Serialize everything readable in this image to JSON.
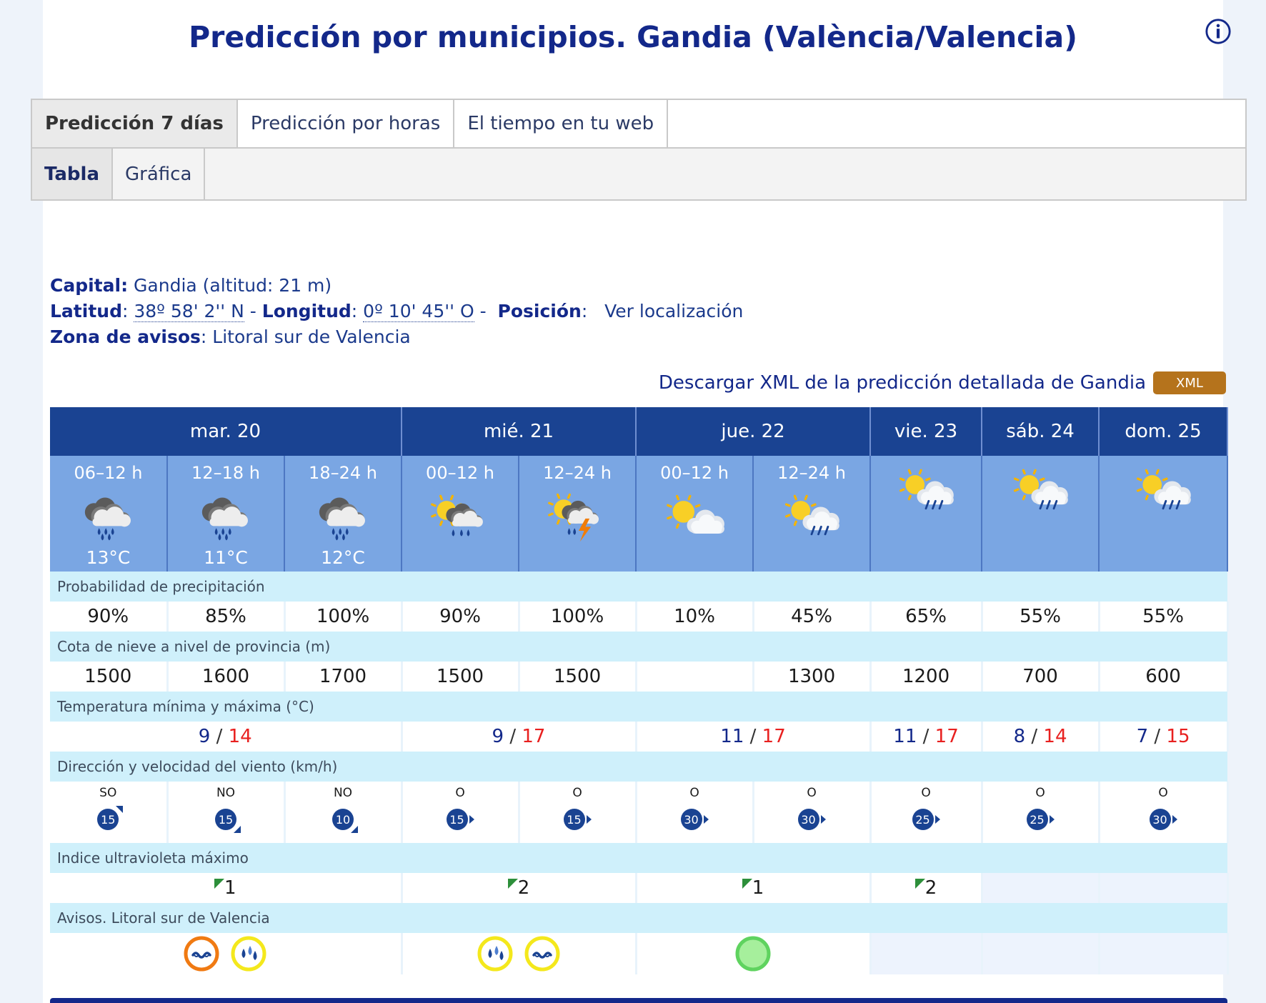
{
  "page": {
    "title": "Predicción por municipios. Gandia (València/Valencia)"
  },
  "tabs_main": [
    {
      "label": "Predicción 7 días",
      "active": true
    },
    {
      "label": "Predicción por horas",
      "active": false
    },
    {
      "label": "El tiempo en tu web",
      "active": false
    }
  ],
  "tabs_sub": [
    {
      "label": "Tabla",
      "active": true
    },
    {
      "label": "Gráfica",
      "active": false
    }
  ],
  "meta": {
    "capital_label": "Capital:",
    "capital_value": "Gandia (altitud: 21 m)",
    "lat_label": "Latitud",
    "lat_value": "38º 58' 2'' N",
    "lon_label": "Longitud",
    "lon_value": "0º 10' 45'' O",
    "pos_label": "Posición",
    "pos_value": "Ver localización",
    "zona_label": "Zona de avisos",
    "zona_value": "Litoral sur de Valencia",
    "colon": ":",
    "dash": "-"
  },
  "xml": {
    "label": "Descargar XML de la predicción detallada de Gandia",
    "badge": "XML",
    "badge_color": "#b5731c"
  },
  "forecast": {
    "days": [
      {
        "label": "mar. 20",
        "span": 3
      },
      {
        "label": "mié. 21",
        "span": 2
      },
      {
        "label": "jue. 22",
        "span": 2
      },
      {
        "label": "vie. 23",
        "span": 1
      },
      {
        "label": "sáb. 24",
        "span": 1
      },
      {
        "label": "dom. 25",
        "span": 1
      }
    ],
    "periods": [
      {
        "label": "06–12 h",
        "icon": "rain-cloud-icon",
        "temp": "13°C"
      },
      {
        "label": "12–18 h",
        "icon": "rain-cloud-icon",
        "temp": "11°C"
      },
      {
        "label": "18–24 h",
        "icon": "rain-cloud-icon",
        "temp": "12°C"
      },
      {
        "label": "00–12 h",
        "icon": "sun-cloud-rain-icon",
        "temp": ""
      },
      {
        "label": "12–24 h",
        "icon": "sun-cloud-storm-icon",
        "temp": ""
      },
      {
        "label": "00–12 h",
        "icon": "sun-cloud-icon",
        "temp": ""
      },
      {
        "label": "12–24 h",
        "icon": "sun-cloud-light-rain-icon",
        "temp": ""
      },
      {
        "label": "",
        "icon": "sun-cloud-light-rain-icon",
        "temp": ""
      },
      {
        "label": "",
        "icon": "sun-cloud-light-rain-icon",
        "temp": ""
      },
      {
        "label": "",
        "icon": "sun-cloud-light-rain-icon",
        "temp": ""
      }
    ],
    "precip": {
      "header": "Probabilidad de precipitación",
      "values": [
        "90%",
        "85%",
        "100%",
        "90%",
        "100%",
        "10%",
        "45%",
        "65%",
        "55%",
        "55%"
      ]
    },
    "snow": {
      "header": "Cota de nieve a nivel de provincia (m)",
      "values": [
        "1500",
        "1600",
        "1700",
        "1500",
        "1500",
        "",
        "1300",
        "1200",
        "700",
        "600"
      ]
    },
    "temp": {
      "header": "Temperatura mínima y máxima (°C)",
      "separator": " / ",
      "values": [
        {
          "min": "9",
          "max": "14",
          "span": 3
        },
        {
          "min": "9",
          "max": "17",
          "span": 2
        },
        {
          "min": "11",
          "max": "17",
          "span": 2
        },
        {
          "min": "11",
          "max": "17",
          "span": 1
        },
        {
          "min": "8",
          "max": "14",
          "span": 1
        },
        {
          "min": "7",
          "max": "15",
          "span": 1
        }
      ]
    },
    "wind": {
      "header": "Dirección y velocidad del viento (km/h)",
      "values": [
        {
          "dir": "SO",
          "speed": "15",
          "arrow": "ne"
        },
        {
          "dir": "NO",
          "speed": "15",
          "arrow": "se"
        },
        {
          "dir": "NO",
          "speed": "10",
          "arrow": "se"
        },
        {
          "dir": "O",
          "speed": "15",
          "arrow": "e"
        },
        {
          "dir": "O",
          "speed": "15",
          "arrow": "e"
        },
        {
          "dir": "O",
          "speed": "30",
          "arrow": "e"
        },
        {
          "dir": "O",
          "speed": "30",
          "arrow": "e"
        },
        {
          "dir": "O",
          "speed": "25",
          "arrow": "e"
        },
        {
          "dir": "O",
          "speed": "25",
          "arrow": "e"
        },
        {
          "dir": "O",
          "speed": "30",
          "arrow": "e"
        }
      ]
    },
    "uv": {
      "header": "Indice ultravioleta máximo",
      "values": [
        {
          "value": "1",
          "span": 3
        },
        {
          "value": "2",
          "span": 2
        },
        {
          "value": "1",
          "span": 2
        },
        {
          "value": "2",
          "span": 1
        },
        {
          "value": "",
          "span": 1
        },
        {
          "value": "",
          "span": 1
        }
      ]
    },
    "alerts": {
      "header": "Avisos. Litoral sur de Valencia",
      "values": [
        {
          "span": 3,
          "items": [
            {
              "icon": "coastal-wave-alert-icon",
              "color": "#f07a12"
            },
            {
              "icon": "rain-drops-alert-icon",
              "color": "#f4e81c"
            }
          ]
        },
        {
          "span": 2,
          "items": [
            {
              "icon": "rain-drops-alert-icon",
              "color": "#f4e81c"
            },
            {
              "icon": "coastal-wave-alert-icon",
              "color": "#f4e81c"
            }
          ]
        },
        {
          "span": 2,
          "items": [
            {
              "icon": "no-alert-green-icon",
              "color": "#5fd35f"
            }
          ]
        },
        {
          "span": 1,
          "items": []
        },
        {
          "span": 1,
          "items": []
        },
        {
          "span": 1,
          "items": []
        }
      ]
    }
  }
}
